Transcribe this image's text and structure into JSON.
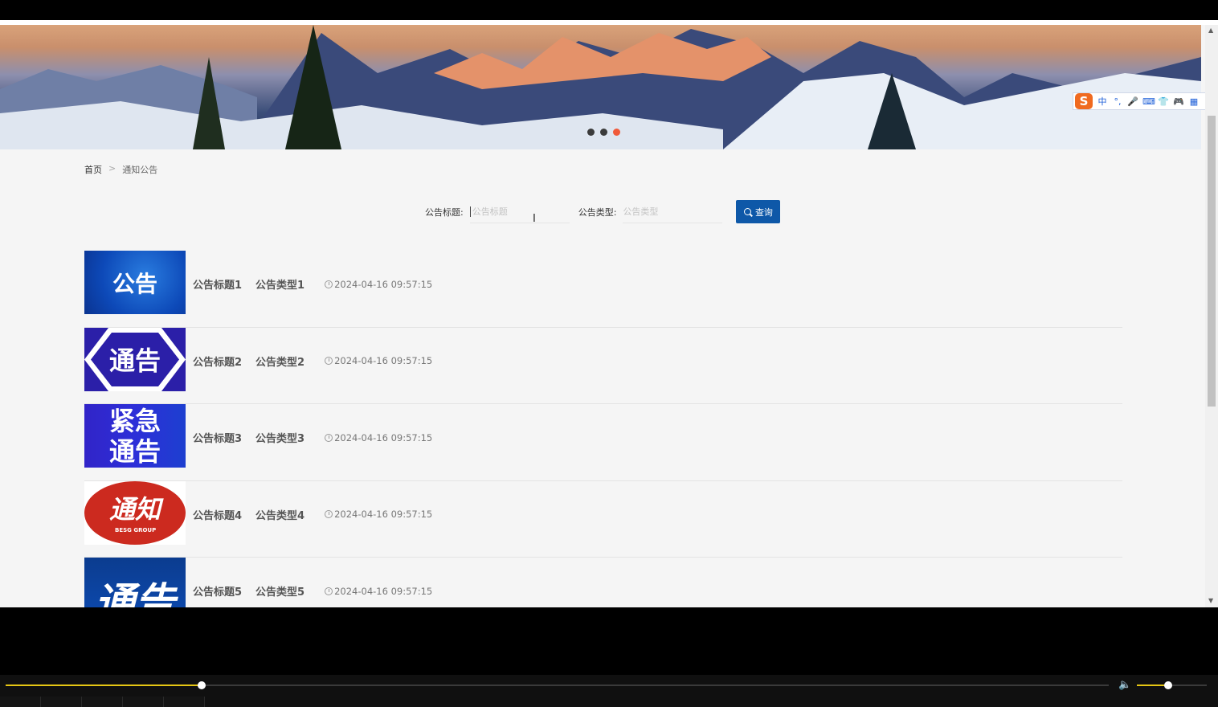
{
  "banner": {
    "slides": 3,
    "active_slide": 3
  },
  "ime": {
    "items": [
      "中",
      "°,",
      "🎤",
      "⌨",
      "👕",
      "🎮",
      "▦",
      "⚙"
    ]
  },
  "breadcrumb": {
    "home": "首页",
    "separator": ">",
    "current": "通知公告"
  },
  "search": {
    "title_label": "公告标题:",
    "title_placeholder": "公告标题",
    "type_label": "公告类型:",
    "type_placeholder": "公告类型",
    "button_label": "查询"
  },
  "notices": [
    {
      "title": "公告标题1",
      "type": "公告类型1",
      "time": "2024-04-16 09:57:15",
      "image_text": "公告"
    },
    {
      "title": "公告标题2",
      "type": "公告类型2",
      "time": "2024-04-16 09:57:15",
      "image_text": "通告"
    },
    {
      "title": "公告标题3",
      "type": "公告类型3",
      "time": "2024-04-16 09:57:15",
      "image_text_1": "紧急",
      "image_text_2": "通告"
    },
    {
      "title": "公告标题4",
      "type": "公告类型4",
      "time": "2024-04-16 09:57:15",
      "image_text": "通知",
      "image_subtext": "BESG GROUP"
    },
    {
      "title": "公告标题5",
      "type": "公告类型5",
      "time": "2024-04-16 09:57:15",
      "image_text": "通告"
    }
  ],
  "player": {
    "progress": 0.178,
    "volume": 0.45,
    "accent": "#e6c614"
  }
}
